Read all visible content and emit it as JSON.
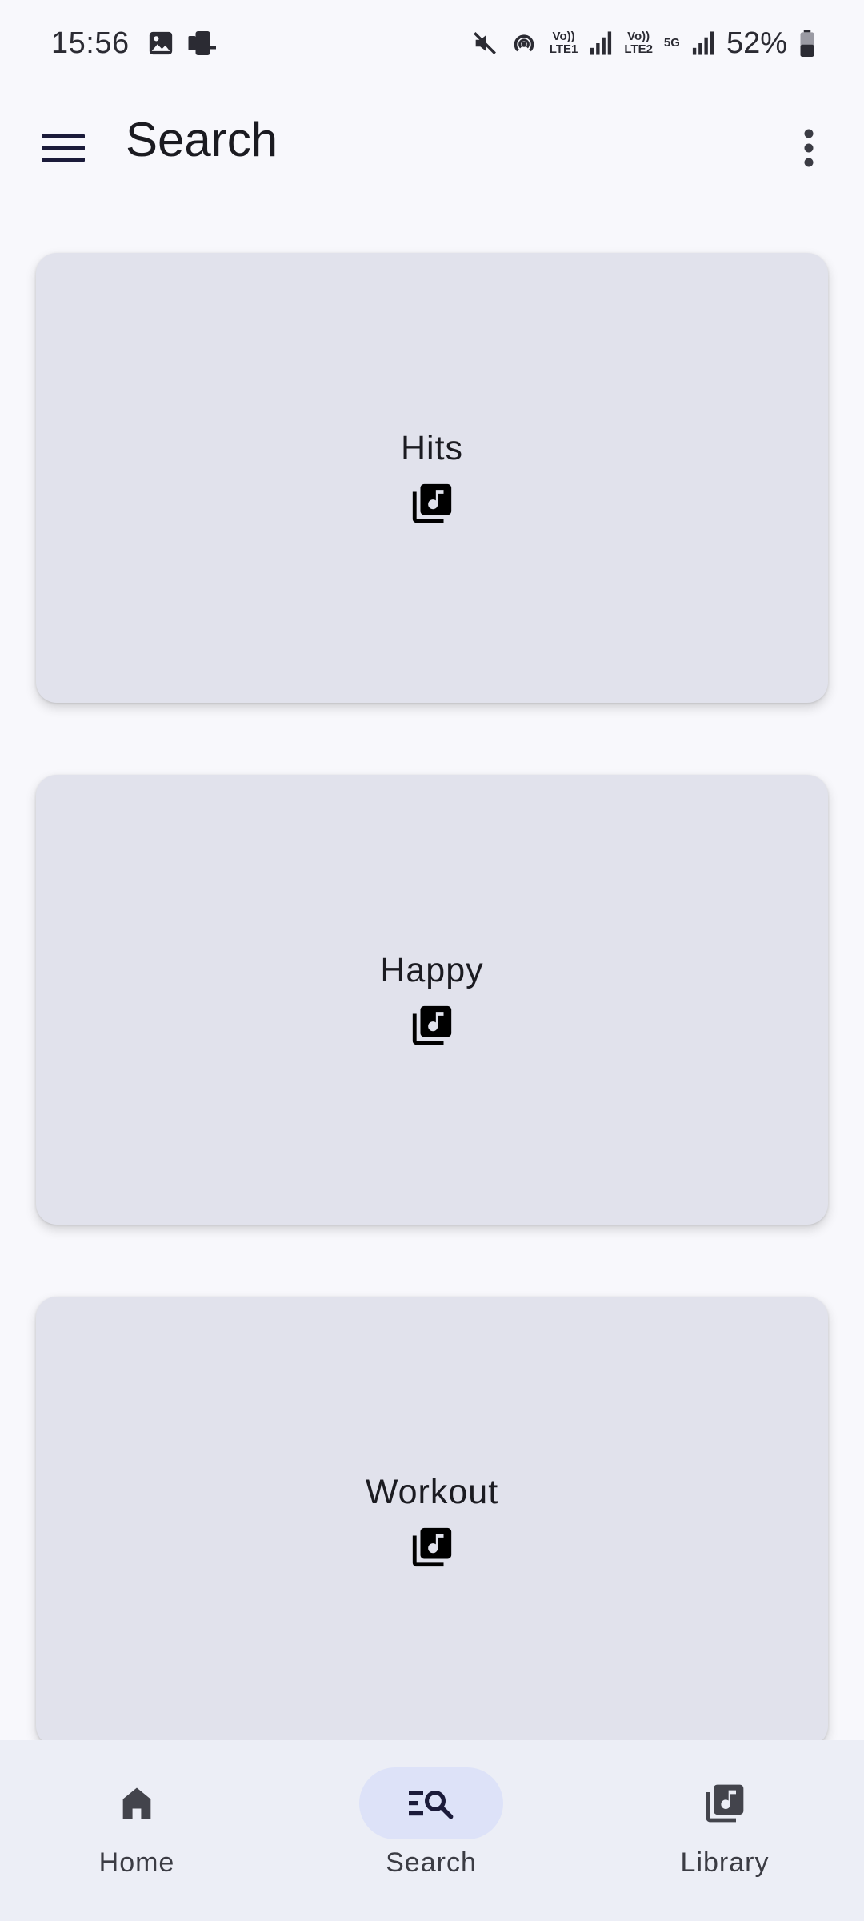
{
  "status_bar": {
    "time": "15:56",
    "lte1": "VoLTE1",
    "lte2": "VoLTE2",
    "network": "5G",
    "battery": "52%"
  },
  "app_bar": {
    "title": "Search"
  },
  "cards": [
    {
      "label": "Hits",
      "icon": "music-library-icon"
    },
    {
      "label": "Happy",
      "icon": "music-library-icon"
    },
    {
      "label": "Workout",
      "icon": "music-library-icon"
    }
  ],
  "bottom_nav": {
    "items": [
      {
        "label": "Home",
        "icon": "home-icon",
        "active": false
      },
      {
        "label": "Search",
        "icon": "search-list-icon",
        "active": true
      },
      {
        "label": "Library",
        "icon": "music-library-icon",
        "active": false
      }
    ]
  },
  "colors": {
    "background": "#f8f8fc",
    "card": "#e1e2ec",
    "nav_background": "#eceef6",
    "nav_active_indicator": "#dde2f8",
    "text_primary": "#1b1b21"
  }
}
